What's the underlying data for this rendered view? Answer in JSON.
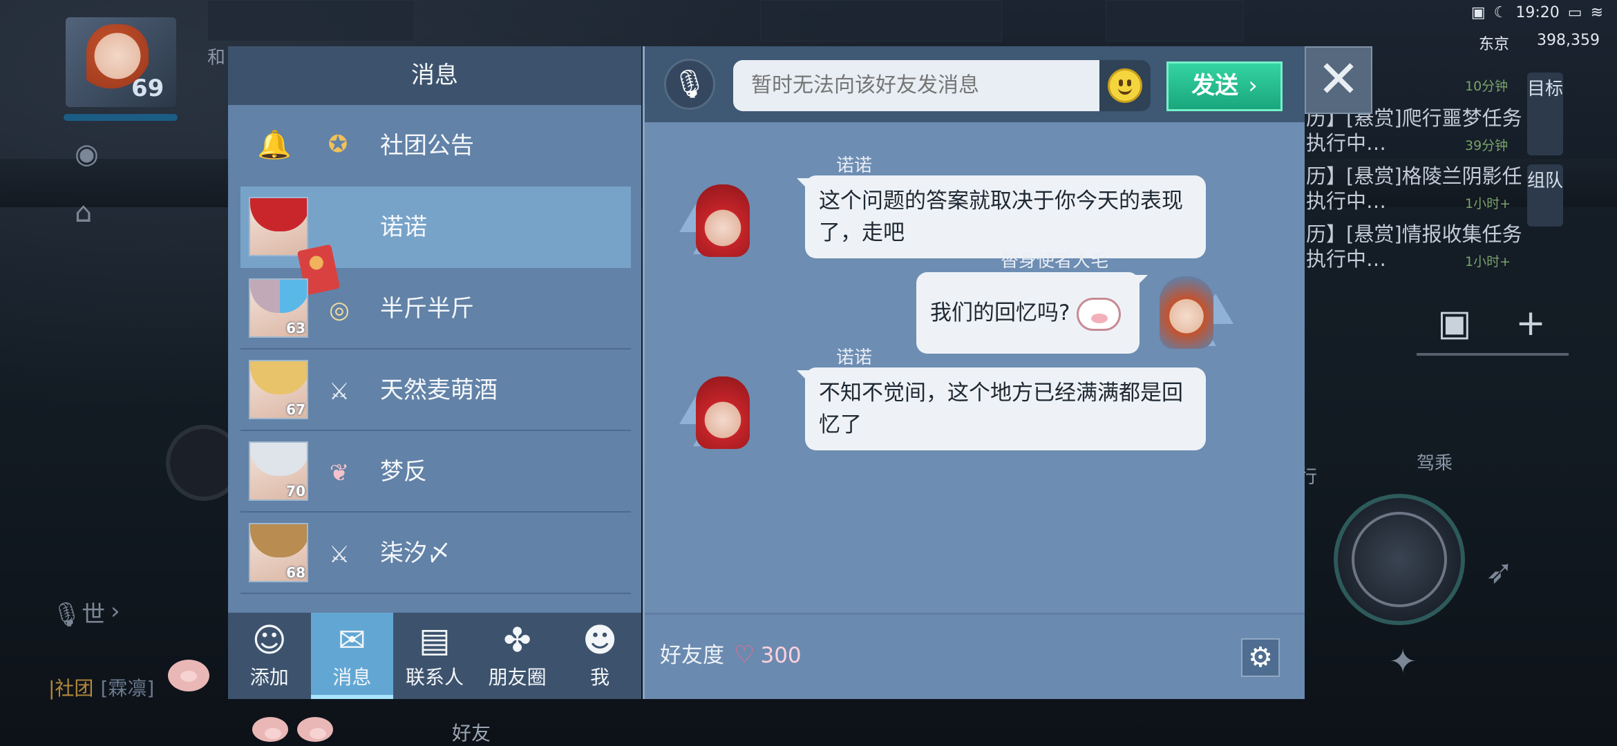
{
  "status_bar": {
    "time": "19:20",
    "location": "东京",
    "coords": "398,359"
  },
  "hud": {
    "level": "69",
    "top_tag": "和",
    "world_chat": "世"
  },
  "quests": [
    {
      "text": "历】[悬赏]爬行噩梦任务",
      "sub": "执行中…",
      "time": "10分钟"
    },
    {
      "text": "历】[悬赏]格陵兰阴影任",
      "sub": "执行中…",
      "time": "39分钟"
    },
    {
      "text": "历】[悬赏]情报收集任务",
      "sub": "执行中…",
      "time": "1小时+"
    },
    {
      "text": "",
      "sub": "",
      "time": "1小时+"
    }
  ],
  "side_tabs": {
    "goal": "目标",
    "team": "组队"
  },
  "right_hud": {
    "drive": "驾乘",
    "run": "行"
  },
  "bottom_chat": {
    "channel": "|社团",
    "name": "[霖凛]"
  },
  "bottom_nav": {
    "friend": "好友"
  },
  "dialog": {
    "left_title": "消息",
    "conversations": [
      {
        "name": "社团公告",
        "badge_icon": "bell-icon",
        "level": ""
      },
      {
        "name": "诺诺",
        "badge_icon": "",
        "level": ""
      },
      {
        "name": "半斤半斤",
        "badge_icon": "eye-emblem-icon",
        "level": "63"
      },
      {
        "name": "天然麦萌酒",
        "badge_icon": "crossed-swords-icon",
        "level": "67"
      },
      {
        "name": "梦反",
        "badge_icon": "wing-emblem-icon",
        "level": "70"
      },
      {
        "name": "柒汐〆",
        "badge_icon": "crossed-swords-icon",
        "level": "68"
      }
    ],
    "tabs": [
      {
        "label": "添加",
        "icon": "add-friend-icon"
      },
      {
        "label": "消息",
        "icon": "message-icon"
      },
      {
        "label": "联系人",
        "icon": "contacts-icon"
      },
      {
        "label": "朋友圈",
        "icon": "moments-icon"
      },
      {
        "label": "我",
        "icon": "profile-icon"
      }
    ],
    "input_placeholder": "暂时无法向该好友发消息",
    "send_label": "发送",
    "messages": [
      {
        "sender": "诺诺",
        "side": "left",
        "text": "这个问题的答案就取决于你今天的表现了，走吧"
      },
      {
        "sender": "替身使者大毛",
        "side": "right",
        "text": "我们的回忆吗?"
      },
      {
        "sender": "诺诺",
        "side": "left",
        "text": "不知不觉间，这个地方已经满满都是回忆了"
      }
    ],
    "friendship_label": "好友度",
    "friendship_score": "300"
  },
  "colors": {
    "accent": "#62a7d4",
    "send": "#1fb587",
    "heart": "#f06b8b"
  }
}
